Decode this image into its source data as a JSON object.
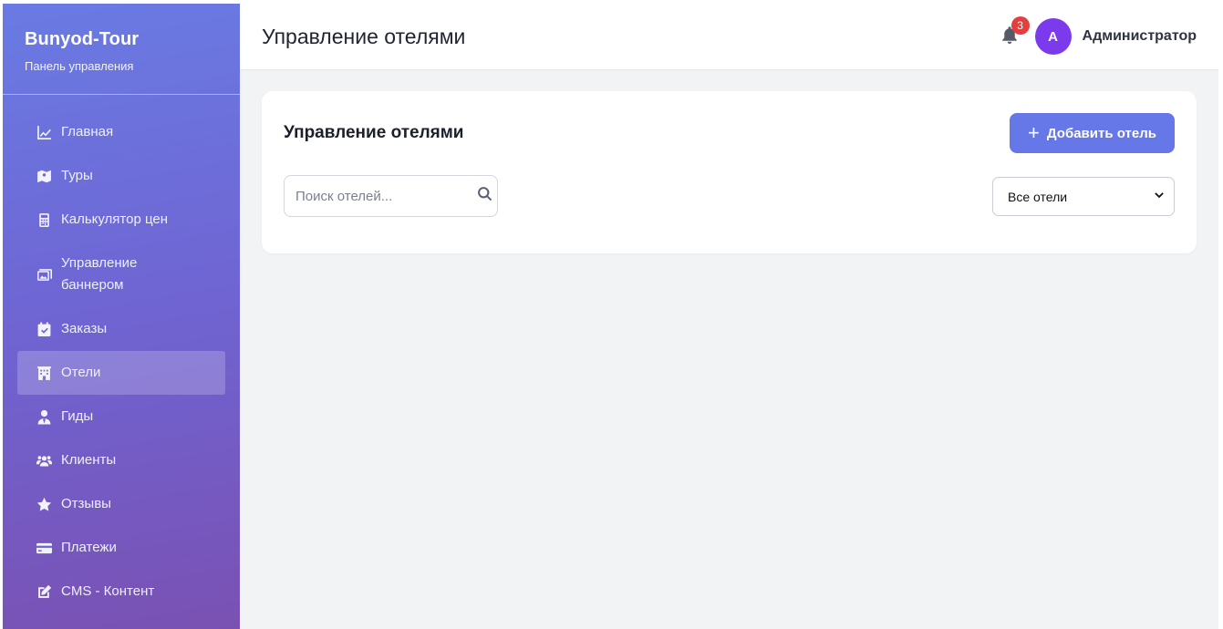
{
  "brand": {
    "name": "Bunyod-Tour",
    "subtitle": "Панель управления"
  },
  "nav": [
    {
      "label": "Главная",
      "icon": "chart-line-icon"
    },
    {
      "label": "Туры",
      "icon": "map-icon"
    },
    {
      "label": "Калькулятор цен",
      "icon": "calculator-icon"
    },
    {
      "label": "Управление баннером",
      "icon": "images-icon"
    },
    {
      "label": "Заказы",
      "icon": "calendar-check-icon"
    },
    {
      "label": "Отели",
      "icon": "hotel-icon",
      "active": true
    },
    {
      "label": "Гиды",
      "icon": "user-tie-icon"
    },
    {
      "label": "Клиенты",
      "icon": "users-icon"
    },
    {
      "label": "Отзывы",
      "icon": "star-icon"
    },
    {
      "label": "Платежи",
      "icon": "credit-card-icon"
    },
    {
      "label": "CMS - Контент",
      "icon": "edit-icon"
    }
  ],
  "header": {
    "title": "Управление отелями",
    "notifications_count": "3",
    "avatar_initial": "A",
    "user_name": "Администратор"
  },
  "content": {
    "card_title": "Управление отелями",
    "add_button_label": "Добавить отель",
    "search_placeholder": "Поиск отелей...",
    "search_value": "",
    "filter_selected": "Все отели"
  },
  "colors": {
    "accent": "#6677e8",
    "sidebar_gradient_start": "#6a7be3",
    "sidebar_gradient_end": "#7a51b3",
    "avatar": "#7c3aed",
    "badge": "#e53e3e"
  }
}
